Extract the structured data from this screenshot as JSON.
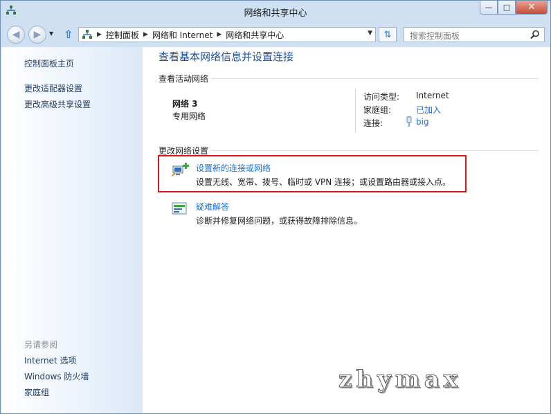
{
  "window": {
    "title": "网络和共享中心",
    "controls": {
      "minimize": "—",
      "maximize": "□",
      "close": "✕"
    }
  },
  "navbar": {
    "breadcrumbs": [
      "控制面板",
      "网络和 Internet",
      "网络和共享中心"
    ],
    "search_placeholder": "搜索控制面板"
  },
  "sidebar": {
    "home": "控制面板主页",
    "links": [
      "更改适配器设置",
      "更改高级共享设置"
    ],
    "see_also_label": "另请参阅",
    "see_also": [
      "Internet 选项",
      "Windows 防火墙",
      "家庭组"
    ]
  },
  "main": {
    "heading": "查看基本网络信息并设置连接",
    "active_section": "查看活动网络",
    "network": {
      "name": "网络  3",
      "type": "专用网络",
      "access_type_label": "访问类型:",
      "access_type_value": "Internet",
      "homegroup_label": "家庭组:",
      "homegroup_value": "已加入",
      "connection_label": "连接:",
      "connection_value": "big"
    },
    "change_section": "更改网络设置",
    "tasks": [
      {
        "link": "设置新的连接或网络",
        "desc": "设置无线、宽带、拨号、临时或 VPN 连接；或设置路由器或接入点。",
        "icon": "new-connection-icon"
      },
      {
        "link": "疑难解答",
        "desc": "诊断并修复网络问题，或获得故障排除信息。",
        "icon": "troubleshoot-icon"
      }
    ]
  },
  "watermark": "zhymax",
  "colors": {
    "link": "#1a6fd6",
    "heading": "#1e4e9c",
    "highlight": "#e0141e",
    "sidebar_text": "#1e3a5f"
  }
}
